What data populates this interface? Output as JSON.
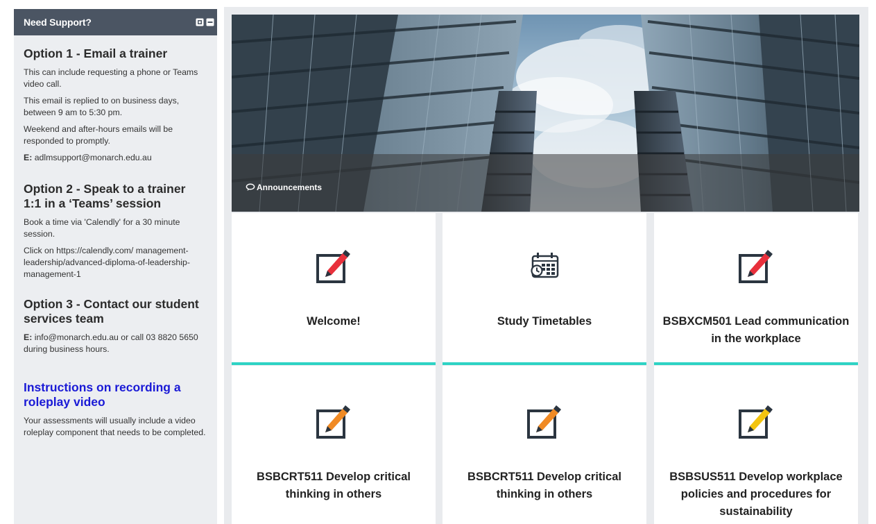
{
  "support": {
    "title": "Need Support?",
    "option1": {
      "heading": "Option 1 - Email a trainer",
      "p1": "This can include requesting a phone or Teams video call.",
      "p2": "This email is replied to on business days, between 9 am to 5:30 pm.",
      "p3": "Weekend and after-hours emails will be responded to promptly.",
      "email_prefix": "E:",
      "email": " adlmsupport@monarch.edu.au"
    },
    "option2": {
      "heading": "Option 2 - Speak to a trainer 1:1 in a ‘Teams’ session",
      "p1": "Book a time via 'Calendly' for a 30 minute session.",
      "p2": "Click on https://calendly.com/ management-leadership/advanced-diploma-of-leadership-management-1"
    },
    "option3": {
      "heading": "Option 3 - Contact our student services team",
      "email_prefix": "E:",
      "p1": " info@monarch.edu.au or call 03 8820 5650 during business hours."
    },
    "instructions": {
      "heading": "Instructions on recording a roleplay video",
      "p1": "Your assessments will usually include a video roleplay component that needs to be completed."
    }
  },
  "banner": {
    "announcements_label": "Announcements",
    "icon": "chat-bubble-icon"
  },
  "tiles": [
    {
      "label": "Welcome!",
      "icon": "edit-icon",
      "accent": "#e8303c"
    },
    {
      "label": "Study Timetables",
      "icon": "calendar-icon",
      "accent": "#2b3540"
    },
    {
      "label": "BSBXCM501 Lead communication in the workplace",
      "icon": "edit-icon",
      "accent": "#e8303c"
    },
    {
      "label": "BSBCRT511 Develop critical thinking in others",
      "icon": "edit-icon",
      "accent": "#f08a24"
    },
    {
      "label": "BSBCRT511 Develop critical thinking in others",
      "icon": "edit-icon",
      "accent": "#f08a24"
    },
    {
      "label": "BSBSUS511 Develop workplace policies and procedures for sustainability",
      "icon": "edit-icon",
      "accent": "#f2c40f"
    }
  ],
  "colors": {
    "tile_underline": "#2ed3c4",
    "header_bg": "#4b5563",
    "link": "#1a1ad6"
  }
}
